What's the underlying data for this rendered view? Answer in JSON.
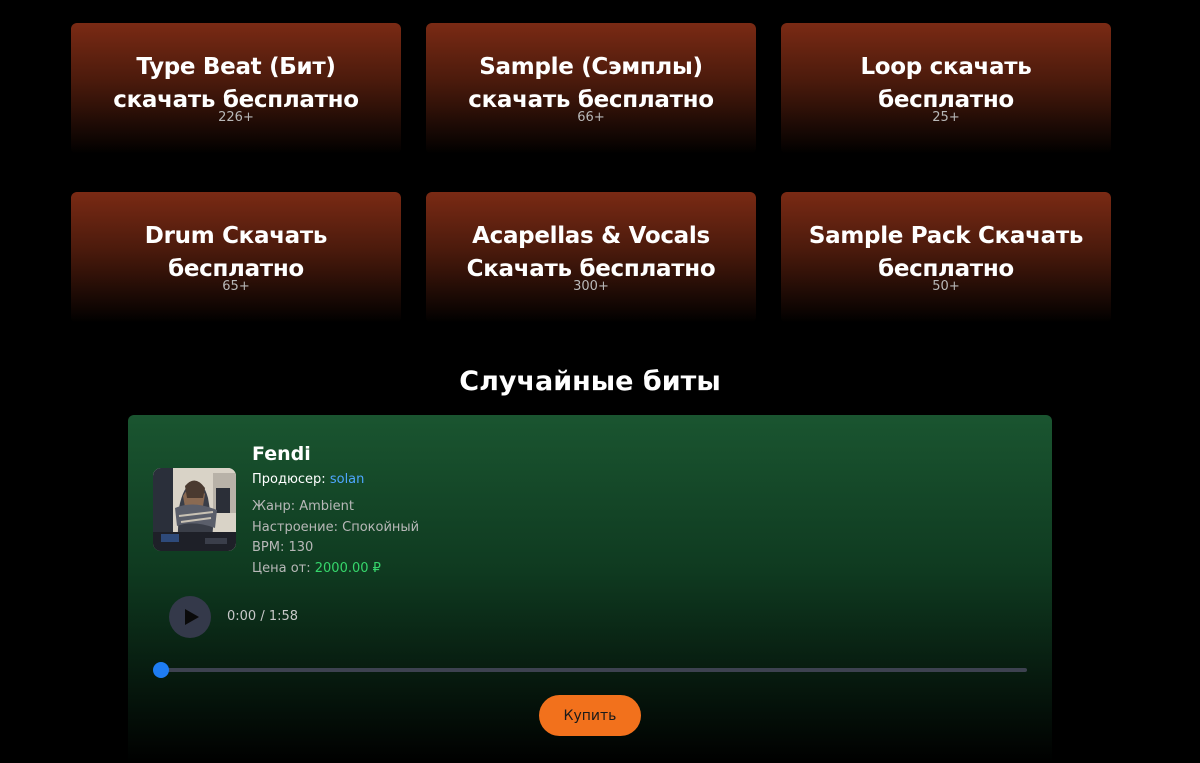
{
  "categories": [
    {
      "title": "Type Beat (Бит) скачать бесплатно",
      "count": "226+"
    },
    {
      "title": "Sample (Сэмплы) скачать бесплатно",
      "count": "66+"
    },
    {
      "title": "Loop скачать бесплатно",
      "count": "25+"
    },
    {
      "title": "Drum Скачать бесплатно",
      "count": "65+"
    },
    {
      "title": "Acapellas & Vocals Скачать бесплатно",
      "count": "300+"
    },
    {
      "title": "Sample Pack Скачать бесплатно",
      "count": "50+"
    }
  ],
  "random_beats": {
    "heading": "Случайные биты",
    "beat": {
      "title": "Fendi",
      "producer_label": "Продюсер:",
      "producer_name": "solan",
      "genre": "Жанр: Ambient",
      "mood": "Настроение: Спокойный",
      "bpm": "BPM: 130",
      "price_label": "Цена от:",
      "price": "2000.00 ₽",
      "time": "0:00 / 1:58",
      "progress": 0,
      "buy_label": "Купить",
      "cover_icon": "album-cover-photo",
      "play_icon": "play-icon"
    }
  },
  "colors": {
    "background": "#000000",
    "card_top": "#7a2a14",
    "beat_card_top": "#1a5530",
    "accent_orange": "#f2711c",
    "link_blue": "#4ea6ff",
    "price_green": "#36d66b",
    "slider_blue": "#1e7cf2"
  }
}
